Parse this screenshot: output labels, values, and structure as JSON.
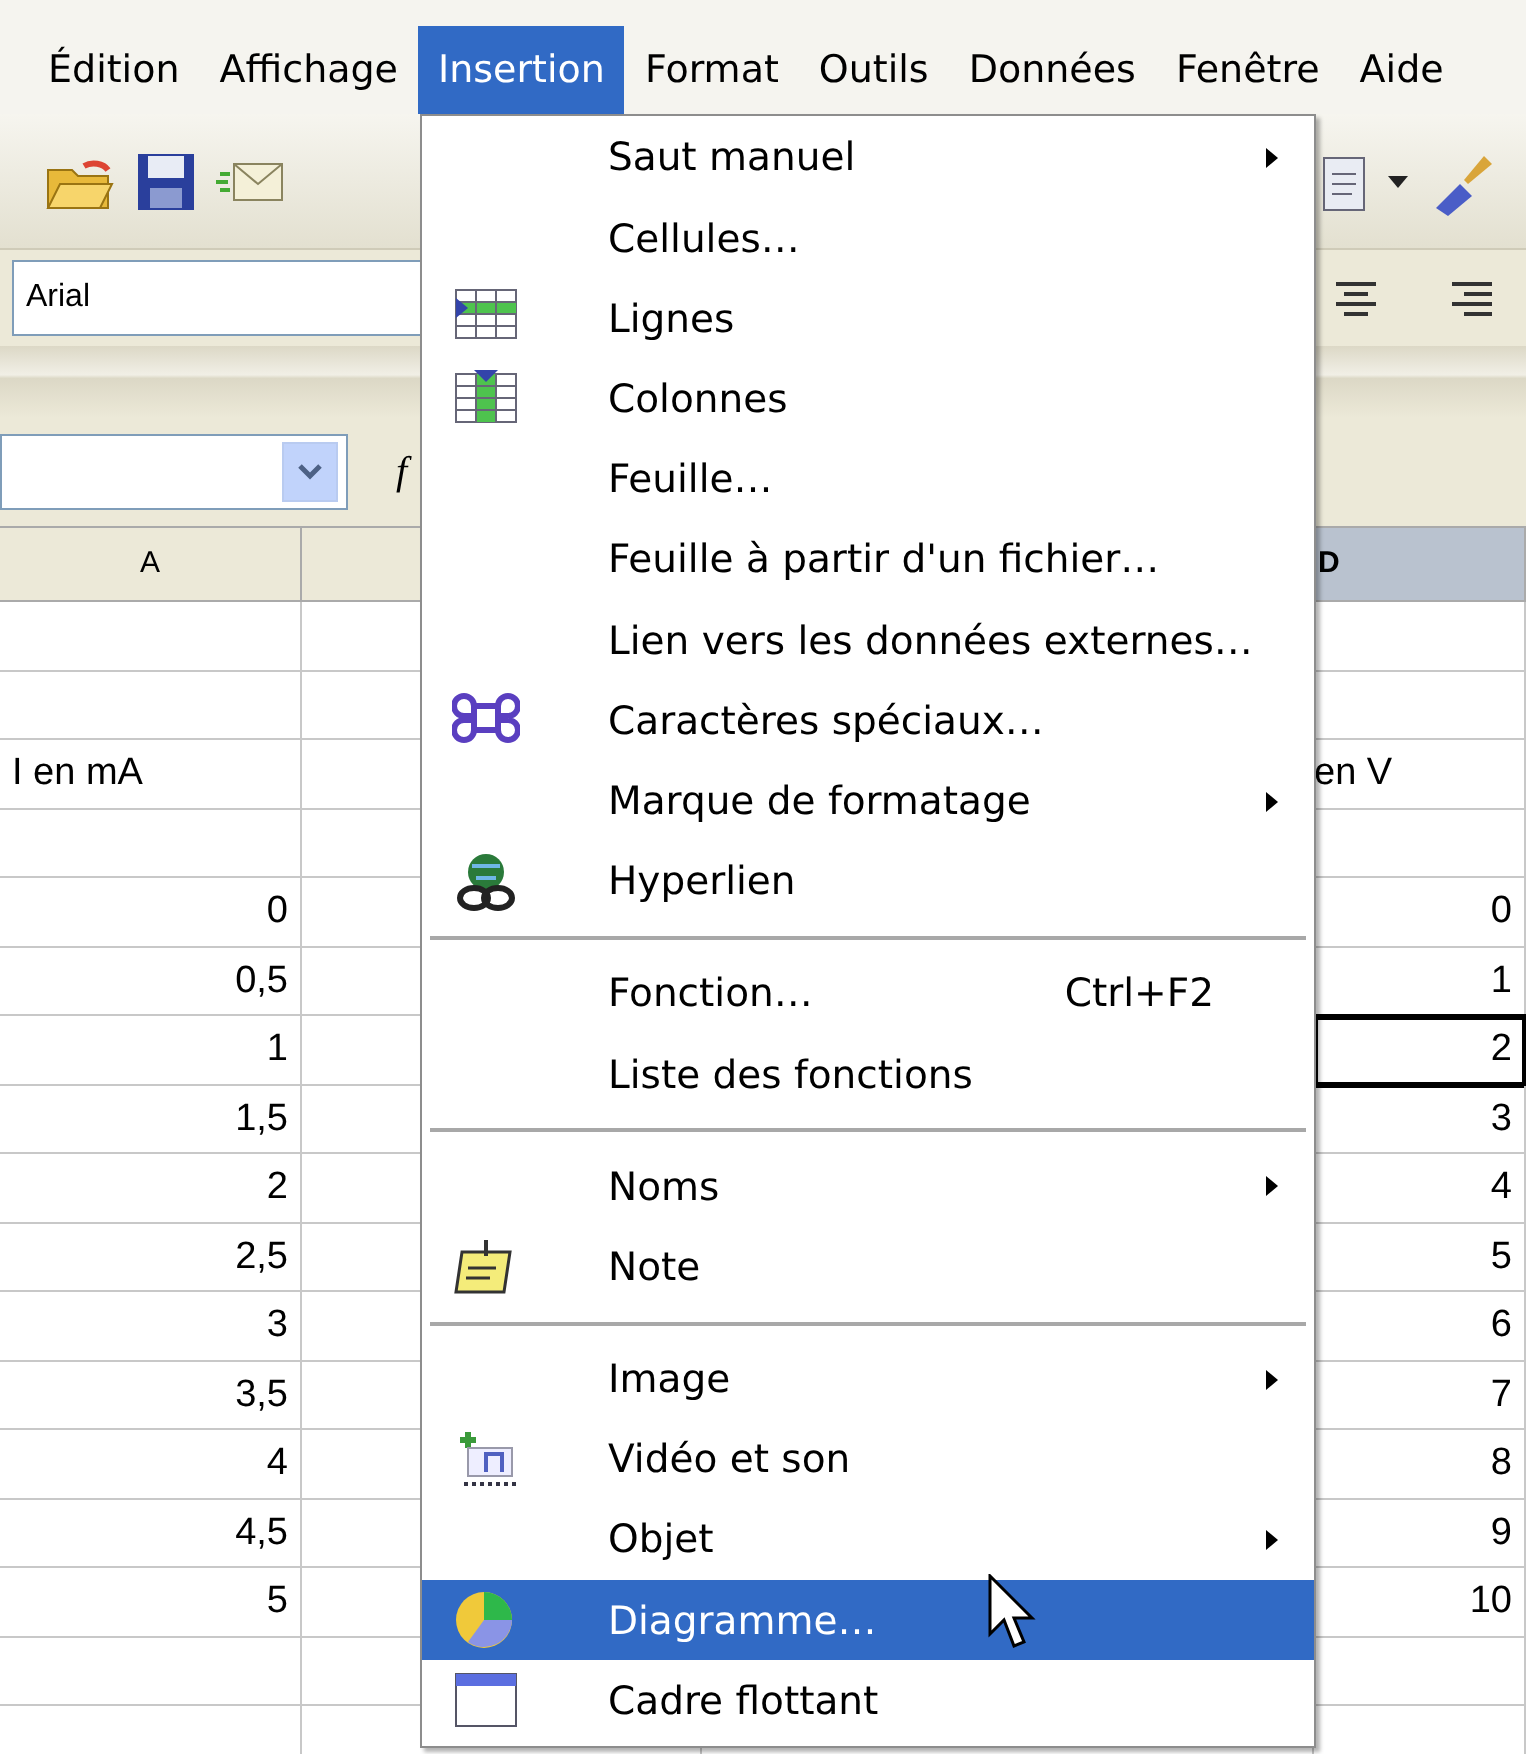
{
  "menubar": [
    {
      "label": "Édition",
      "selected": false
    },
    {
      "label": "Affichage",
      "selected": false
    },
    {
      "label": "Insertion",
      "selected": true
    },
    {
      "label": "Format",
      "selected": false
    },
    {
      "label": "Outils",
      "selected": false
    },
    {
      "label": "Données",
      "selected": false
    },
    {
      "label": "Fenêtre",
      "selected": false
    },
    {
      "label": "Aide",
      "selected": false
    }
  ],
  "font_name": {
    "value": "Arial"
  },
  "formula_bar": {
    "function_label": "f"
  },
  "sheet": {
    "columns": [
      {
        "label": "A",
        "selected": false
      },
      {
        "label": "D",
        "selected": true
      }
    ],
    "rows": [
      {
        "active": false
      },
      {
        "active": false
      },
      {
        "kind": "label",
        "col_a": "I en mA",
        "col_d": "en V",
        "active": false
      },
      {
        "active": false
      },
      {
        "kind": "number",
        "col_a": "0",
        "col_d": "0",
        "active": false
      },
      {
        "kind": "number",
        "col_a": "0,5",
        "col_d": "1",
        "active": false
      },
      {
        "kind": "number",
        "col_a": "1",
        "col_d": "2",
        "active": true
      },
      {
        "kind": "number",
        "col_a": "1,5",
        "col_d": "3",
        "active": false
      },
      {
        "kind": "number",
        "col_a": "2",
        "col_d": "4",
        "active": false
      },
      {
        "kind": "number",
        "col_a": "2,5",
        "col_d": "5",
        "active": false
      },
      {
        "kind": "number",
        "col_a": "3",
        "col_d": "6",
        "active": false
      },
      {
        "kind": "number",
        "col_a": "3,5",
        "col_d": "7",
        "active": false
      },
      {
        "kind": "number",
        "col_a": "4",
        "col_d": "8",
        "active": false
      },
      {
        "kind": "number",
        "col_a": "4,5",
        "col_d": "9",
        "active": false
      },
      {
        "kind": "number",
        "col_a": "5",
        "col_d": "10",
        "active": false
      },
      {
        "active": false
      },
      {
        "active": false
      }
    ]
  },
  "menu": {
    "items": [
      {
        "kind": "item",
        "label": "Saut manuel",
        "submenu": true,
        "selected": false
      },
      {
        "kind": "item",
        "label": "Cellules…",
        "submenu": false,
        "selected": false
      },
      {
        "kind": "item",
        "label": "Lignes",
        "submenu": false,
        "selected": false
      },
      {
        "kind": "item",
        "label": "Colonnes",
        "submenu": false,
        "selected": false
      },
      {
        "kind": "item",
        "label": "Feuille…",
        "submenu": false,
        "selected": false
      },
      {
        "kind": "item",
        "label": "Feuille à partir d'un fichier…",
        "submenu": false,
        "selected": false
      },
      {
        "kind": "item",
        "label": "Lien vers les données externes…",
        "submenu": false,
        "selected": false
      },
      {
        "kind": "item",
        "label": "Caractères spéciaux…",
        "submenu": false,
        "selected": false
      },
      {
        "kind": "item",
        "label": "Marque de formatage",
        "submenu": true,
        "selected": false
      },
      {
        "kind": "item",
        "label": "Hyperlien",
        "submenu": false,
        "selected": false
      },
      {
        "kind": "separator"
      },
      {
        "kind": "item",
        "label": "Fonction…",
        "shortcut": "Ctrl+F2",
        "submenu": false,
        "selected": false
      },
      {
        "kind": "item",
        "label": "Liste des fonctions",
        "submenu": false,
        "selected": false
      },
      {
        "kind": "separator"
      },
      {
        "kind": "item",
        "label": "Noms",
        "submenu": true,
        "selected": false
      },
      {
        "kind": "item",
        "label": "Note",
        "submenu": false,
        "selected": false
      },
      {
        "kind": "separator"
      },
      {
        "kind": "item",
        "label": "Image",
        "submenu": true,
        "selected": false
      },
      {
        "kind": "item",
        "label": "Vidéo et son",
        "submenu": false,
        "selected": false
      },
      {
        "kind": "item",
        "label": "Objet",
        "submenu": true,
        "selected": false
      },
      {
        "kind": "item",
        "label": "Diagramme…",
        "submenu": false,
        "selected": true
      },
      {
        "kind": "item",
        "label": "Cadre flottant",
        "submenu": false,
        "selected": false
      }
    ]
  }
}
